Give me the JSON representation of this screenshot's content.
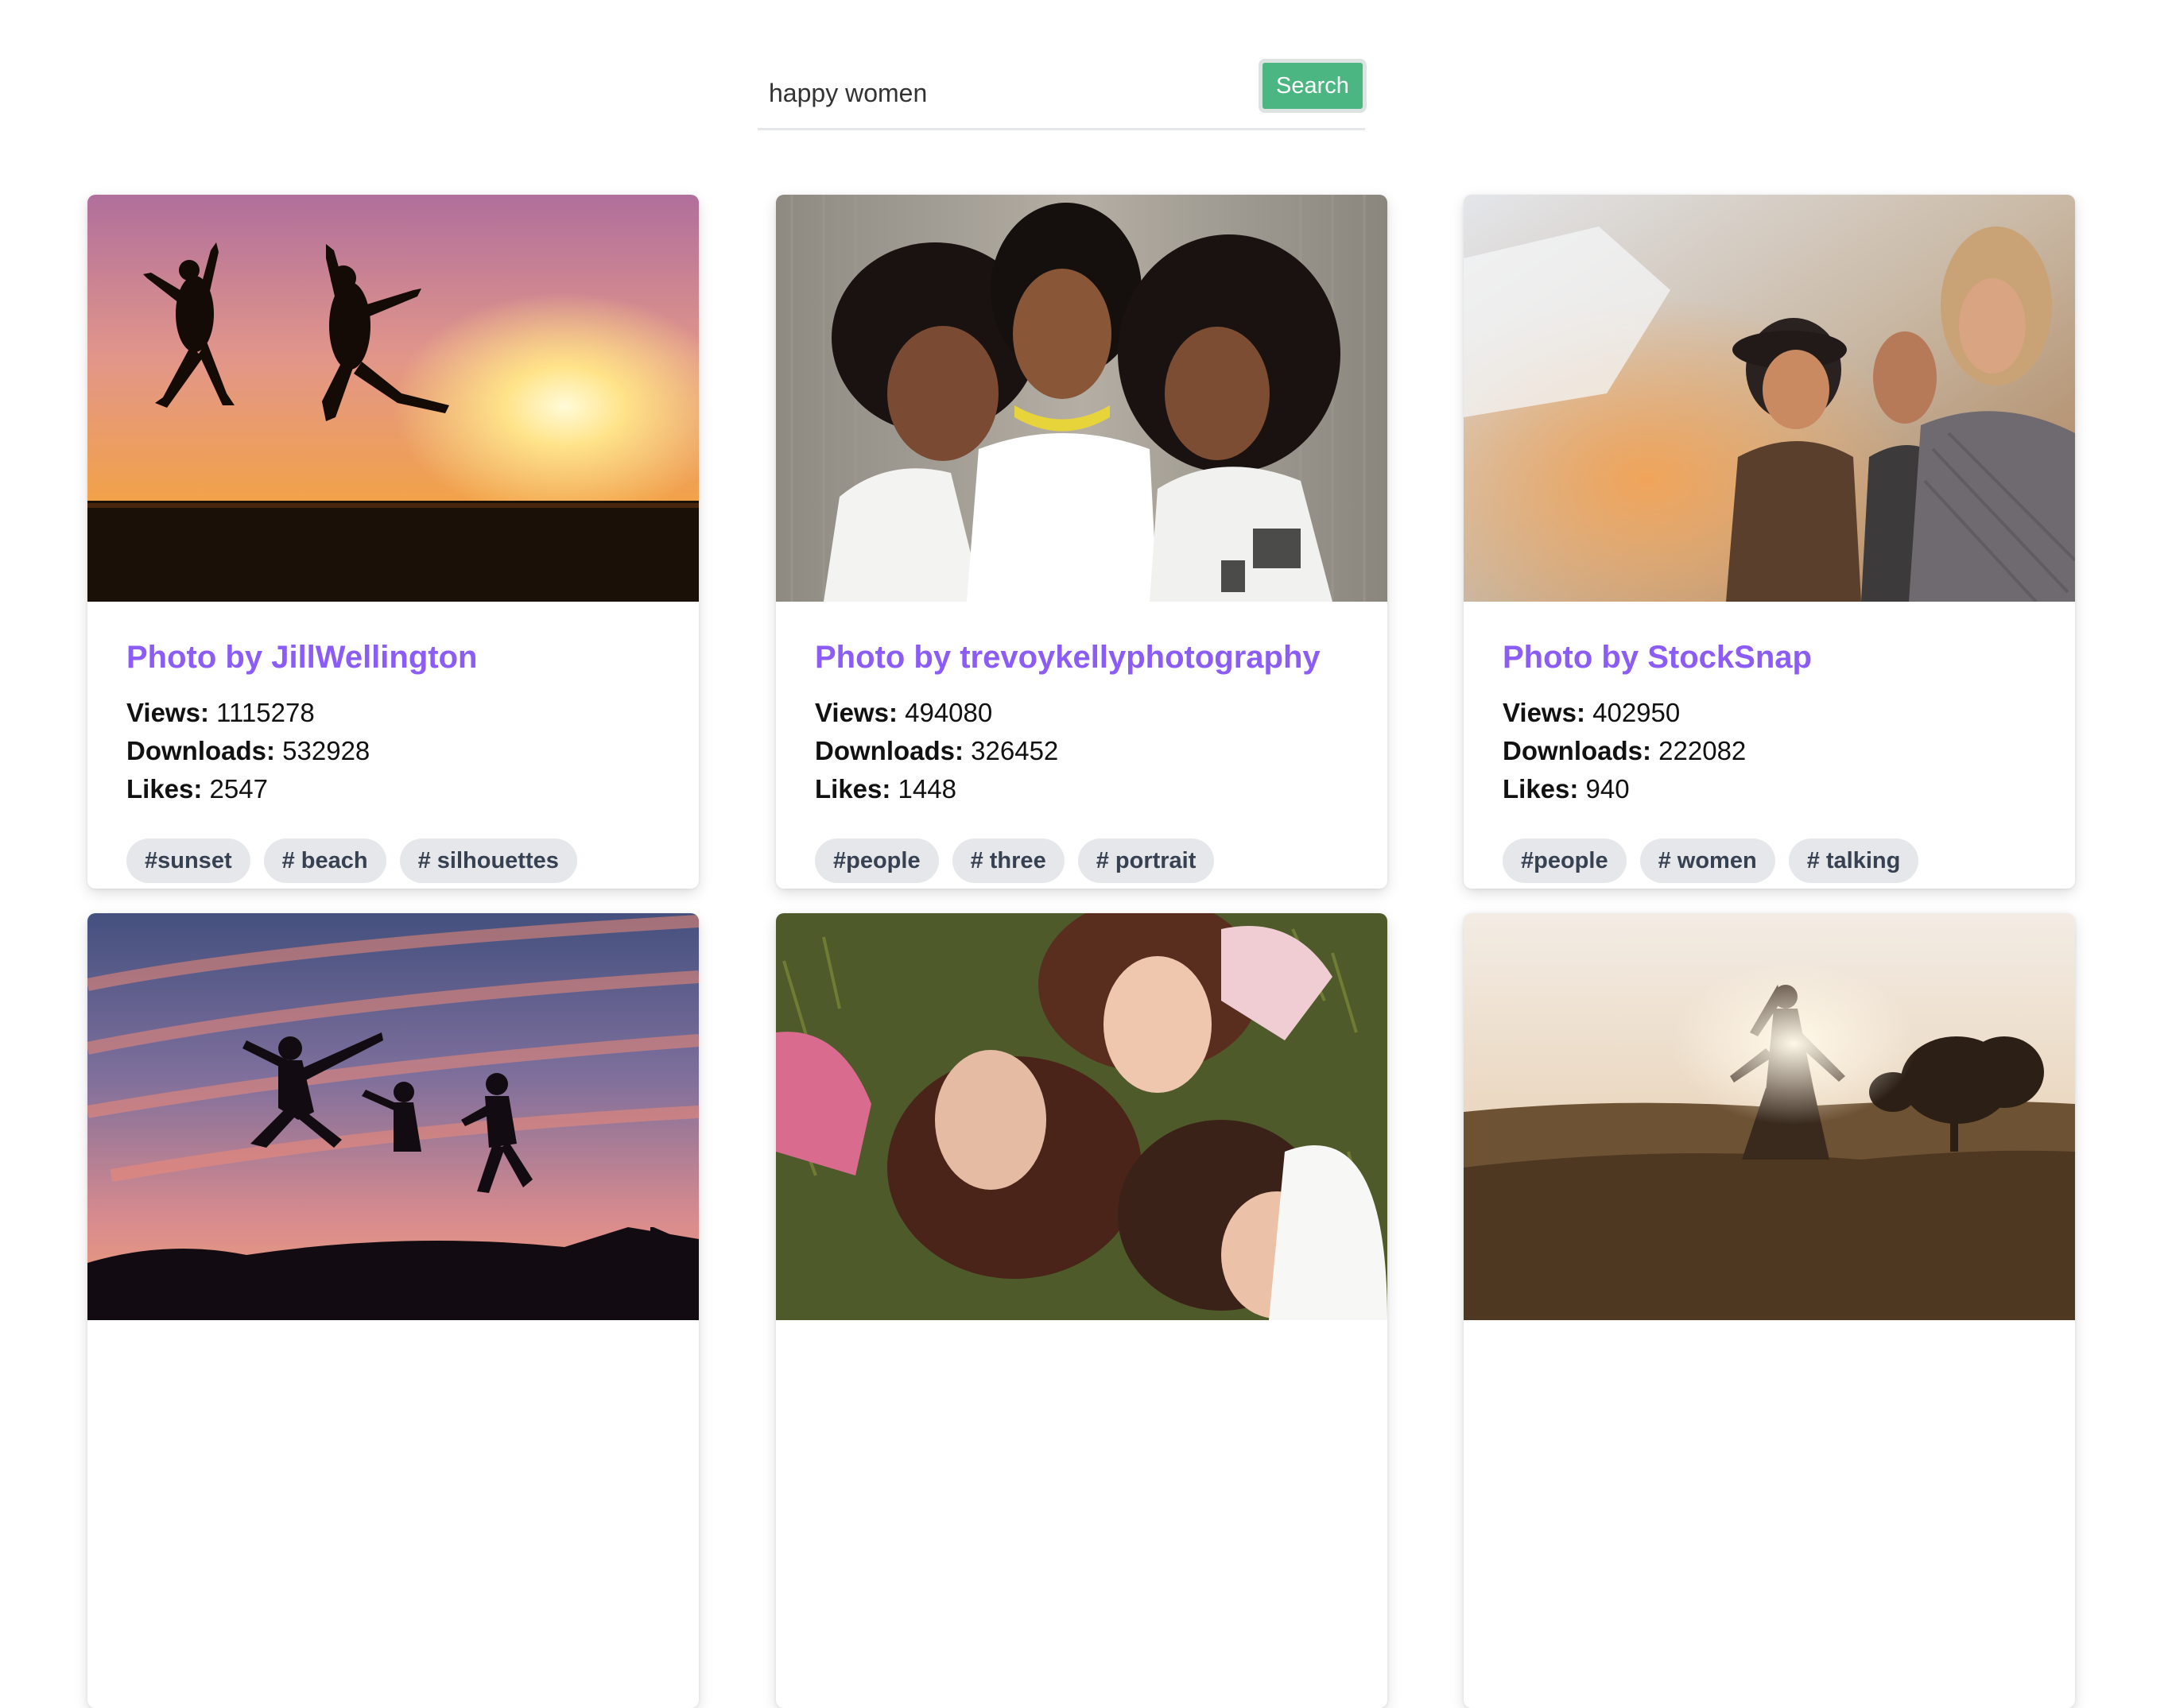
{
  "search": {
    "value": "happy women",
    "button_label": "Search"
  },
  "cards": [
    {
      "author": "Photo by JillWellington",
      "views_label": "Views:",
      "views": "1115278",
      "downloads_label": "Downloads:",
      "downloads": "532928",
      "likes_label": "Likes:",
      "likes": "2547",
      "tags": [
        "#sunset",
        "# beach",
        "# silhouettes"
      ]
    },
    {
      "author": "Photo by trevoykellyphotography",
      "views_label": "Views:",
      "views": "494080",
      "downloads_label": "Downloads:",
      "downloads": "326452",
      "likes_label": "Likes:",
      "likes": "1448",
      "tags": [
        "#people",
        "# three",
        "# portrait"
      ]
    },
    {
      "author": "Photo by StockSnap",
      "views_label": "Views:",
      "views": "402950",
      "downloads_label": "Downloads:",
      "downloads": "222082",
      "likes_label": "Likes:",
      "likes": "940",
      "tags": [
        "#people",
        "# women",
        "# talking"
      ]
    }
  ],
  "colors": {
    "accent": "#8b5cf6",
    "button": "#4cb682",
    "tag_bg": "#e5e7eb"
  }
}
